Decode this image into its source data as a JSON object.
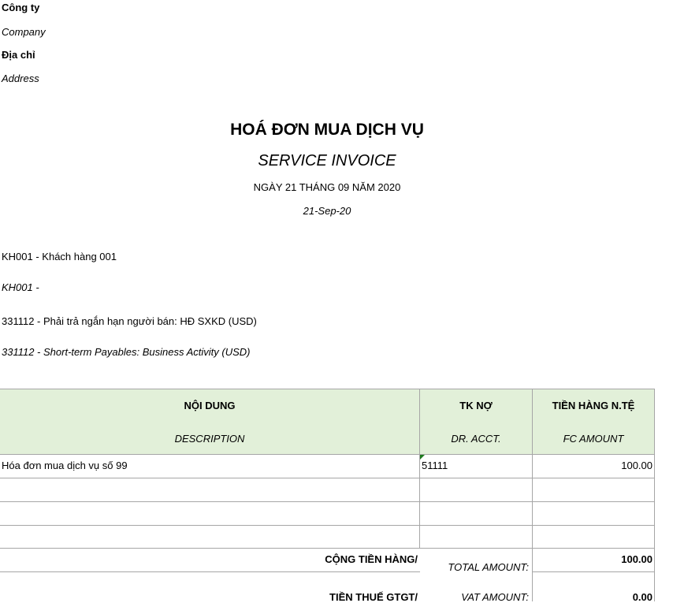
{
  "company": {
    "label_vi": "Công ty",
    "label_en": "Company"
  },
  "address": {
    "label_vi": "Địa chỉ",
    "label_en": "Address"
  },
  "title": {
    "vi": "HOÁ ĐƠN MUA DỊCH VỤ",
    "en": "SERVICE INVOICE",
    "date_vi": "NGÀY 21 THÁNG 09 NĂM 2020",
    "date_en": "21-Sep-20"
  },
  "parties": {
    "customer_vi": "KH001 - Khách hàng 001",
    "customer_en": "KH001 -",
    "account_vi": "331112 - Phải trả ngắn hạn người bán: HĐ SXKD (USD)",
    "account_en": "331112 - Short-term Payables: Business Activity (USD)"
  },
  "table": {
    "headers": [
      {
        "vi": "NỘI DUNG",
        "en": "DESCRIPTION"
      },
      {
        "vi": "TK NỢ",
        "en": "DR. ACCT."
      },
      {
        "vi": "TIỀN HÀNG N.TỆ",
        "en": "FC AMOUNT"
      }
    ],
    "rows": [
      {
        "description": "Hóa đơn mua dịch vụ số 99",
        "account": "51111",
        "amount": "100.00"
      },
      {
        "description": "",
        "account": "",
        "amount": ""
      },
      {
        "description": "",
        "account": "",
        "amount": ""
      },
      {
        "description": "",
        "account": "",
        "amount": ""
      }
    ]
  },
  "totals": {
    "total_vi": "CỘNG TIỀN HÀNG/",
    "total_en": "TOTAL AMOUNT:",
    "total_value": "100.00",
    "vat_vi": "TIỀN THUẾ GTGT/",
    "vat_en": "VAT AMOUNT:",
    "vat_value": "0.00"
  },
  "colors": {
    "header_bg": "#e2f0d9",
    "grid": "#a6a6a6",
    "comment_marker": "#1e7b1e"
  }
}
